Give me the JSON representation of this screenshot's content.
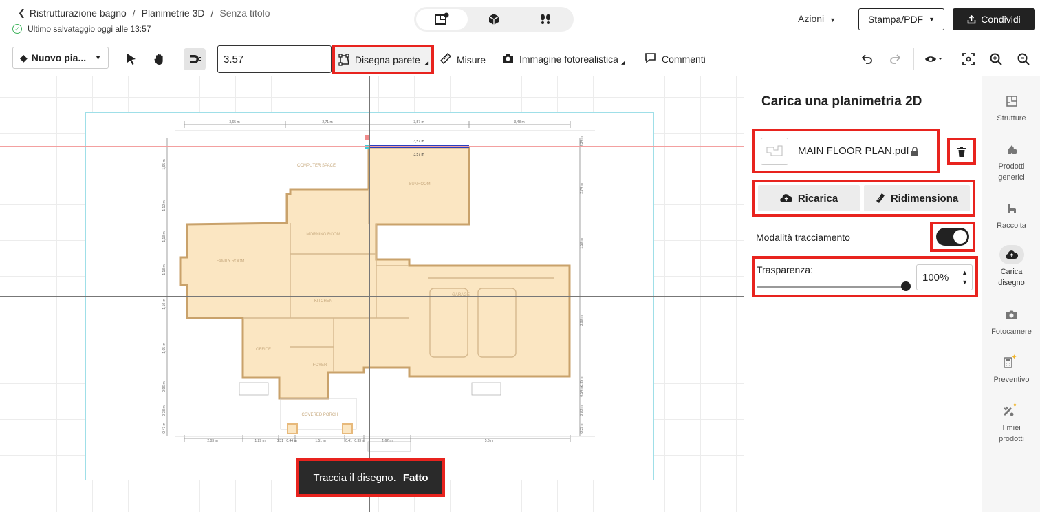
{
  "breadcrumb": {
    "items": [
      "Ristrutturazione bagno",
      "Planimetrie 3D"
    ],
    "current": "Senza titolo"
  },
  "save_status": "Ultimo salvataggio oggi alle 13:57",
  "header": {
    "actions_label": "Azioni",
    "print_label": "Stampa/PDF",
    "share_label": "Condividi",
    "view_modes": [
      "2D",
      "3D",
      "Walk"
    ],
    "active_view": "2D"
  },
  "toolbar": {
    "floor_label": "Nuovo pia...",
    "length_value": "3.57",
    "draw_wall_label": "Disegna parete",
    "measure_label": "Misure",
    "photo_label": "Immagine fotorealistica",
    "comments_label": "Commenti"
  },
  "canvas": {
    "hint_text": "Traccia il disegno.",
    "hint_action": "Fatto",
    "dimensions_top": [
      "3,65 m",
      "2,71 m",
      "3,57 m",
      "3,48 m"
    ],
    "selected_wall_label": "3,57 m",
    "dimensions_bottom": [
      "2,03 m",
      "1,29 m",
      "0,31",
      "0,44 m",
      "1,51 m",
      "0,41",
      "0,33 m",
      "1,62 m",
      "5,6 m"
    ],
    "dimensions_left": [
      "1,65 m",
      "1,12 m",
      "1,13 m",
      "1,18 m",
      "1,16 m",
      "1,65 m",
      "0,96 m",
      "0,78 m",
      "0,47 m"
    ],
    "dimensions_right": [
      "0,34 m",
      "2,74 m",
      "1,59 m",
      "3,69 m",
      "0,35 m",
      "0,54 m",
      "0,78 m",
      "0,39 m"
    ],
    "room_labels": [
      "FAMILY ROOM",
      "MORNING ROOM",
      "KITCHEN",
      "OFFICE",
      "FOYER",
      "SUNROOM",
      "GARAGE",
      "COVERED PORCH",
      "COMPUTER SPACE"
    ]
  },
  "panel": {
    "title": "Carica una planimetria 2D",
    "file_name": "MAIN FLOOR PLAN.pdf",
    "reload_label": "Ricarica",
    "resize_label": "Ridimensiona",
    "trace_mode_label": "Modalità tracciamento",
    "trace_mode_on": true,
    "transparency_label": "Trasparenza:",
    "transparency_value": "100%",
    "transparency_level": 1.0
  },
  "sidebar": {
    "items": [
      {
        "label": "Strutture",
        "icon": "structures-icon"
      },
      {
        "label": "Prodotti generici",
        "icon": "generic-products-icon"
      },
      {
        "label": "Raccolta",
        "icon": "collection-icon"
      },
      {
        "label": "Carica disegno",
        "icon": "upload-cloud-icon",
        "active": true
      },
      {
        "label": "Fotocamere",
        "icon": "camera-icon"
      },
      {
        "label": "Preventivo",
        "icon": "calculator-icon"
      },
      {
        "label": "I miei prodotti",
        "icon": "my-products-icon"
      }
    ]
  },
  "colors": {
    "highlight": "#e8231e",
    "room_fill": "#fbe6c2",
    "wall": "#c9a26b",
    "selected_wall": "#2a3fbf",
    "guide_line": "#f08080",
    "success": "#3fb35c"
  }
}
